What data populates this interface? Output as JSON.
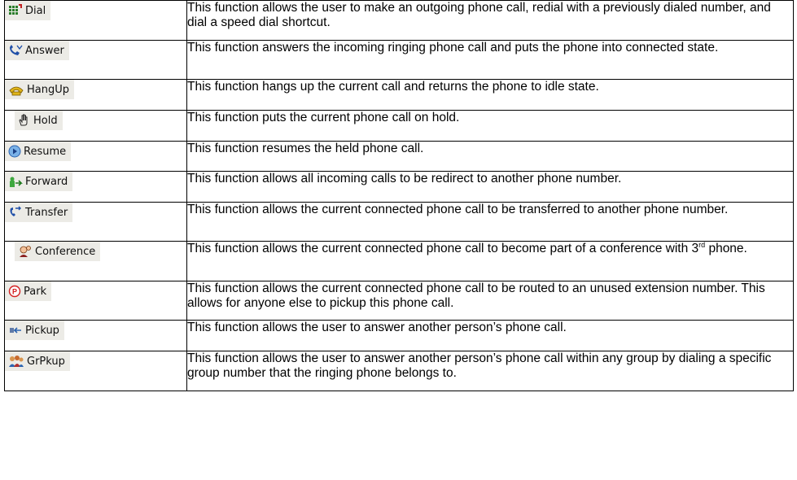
{
  "rows": [
    {
      "id": "dial",
      "button": "Dial",
      "icon": "dial-keypad-icon",
      "description": "This function allows the user to make an outgoing phone call, redial with a previously dialed number, and dial a speed dial shortcut."
    },
    {
      "id": "answer",
      "button": "Answer",
      "icon": "answer-phone-icon",
      "description": "This function answers the incoming ringing phone call and puts the phone into connected state."
    },
    {
      "id": "hangup",
      "button": "HangUp",
      "icon": "hangup-phone-icon",
      "description": "This function hangs up the current call and returns the phone to idle state."
    },
    {
      "id": "hold",
      "button": "Hold",
      "icon": "hold-hand-icon",
      "description": "This function puts the current phone call on hold."
    },
    {
      "id": "resume",
      "button": "Resume",
      "icon": "resume-play-icon",
      "description": "This function resumes the held phone call."
    },
    {
      "id": "forward",
      "button": "Forward",
      "icon": "forward-person-icon",
      "description": "This function allows all incoming calls to be redirect to another phone number."
    },
    {
      "id": "transfer",
      "button": "Transfer",
      "icon": "transfer-phone-icon",
      "description": "This function allows the current connected phone call to be transferred to another phone number."
    },
    {
      "id": "conference",
      "button": "Conference",
      "icon": "conference-people-icon",
      "description": "This function allows the current connected phone call to become part of a conference with 3",
      "description_sup": "rd",
      "description_tail": " phone."
    },
    {
      "id": "park",
      "button": "Park",
      "icon": "park-circle-p-icon",
      "description": "This function allows the current connected phone call to be routed to an unused extension number. This allows for anyone else to pickup this phone call."
    },
    {
      "id": "pickup",
      "button": "Pickup",
      "icon": "pickup-hand-icon",
      "description": "This function allows the user to answer another person’s phone call."
    },
    {
      "id": "grpkup",
      "button": "GrPkup",
      "icon": "group-pickup-icon",
      "description": "This function allows the user to answer another person’s phone call within any group by dialing a specific group number that the ringing phone belongs to."
    }
  ],
  "colors": {
    "button_bg": "#ecebe6",
    "border": "#000000"
  }
}
